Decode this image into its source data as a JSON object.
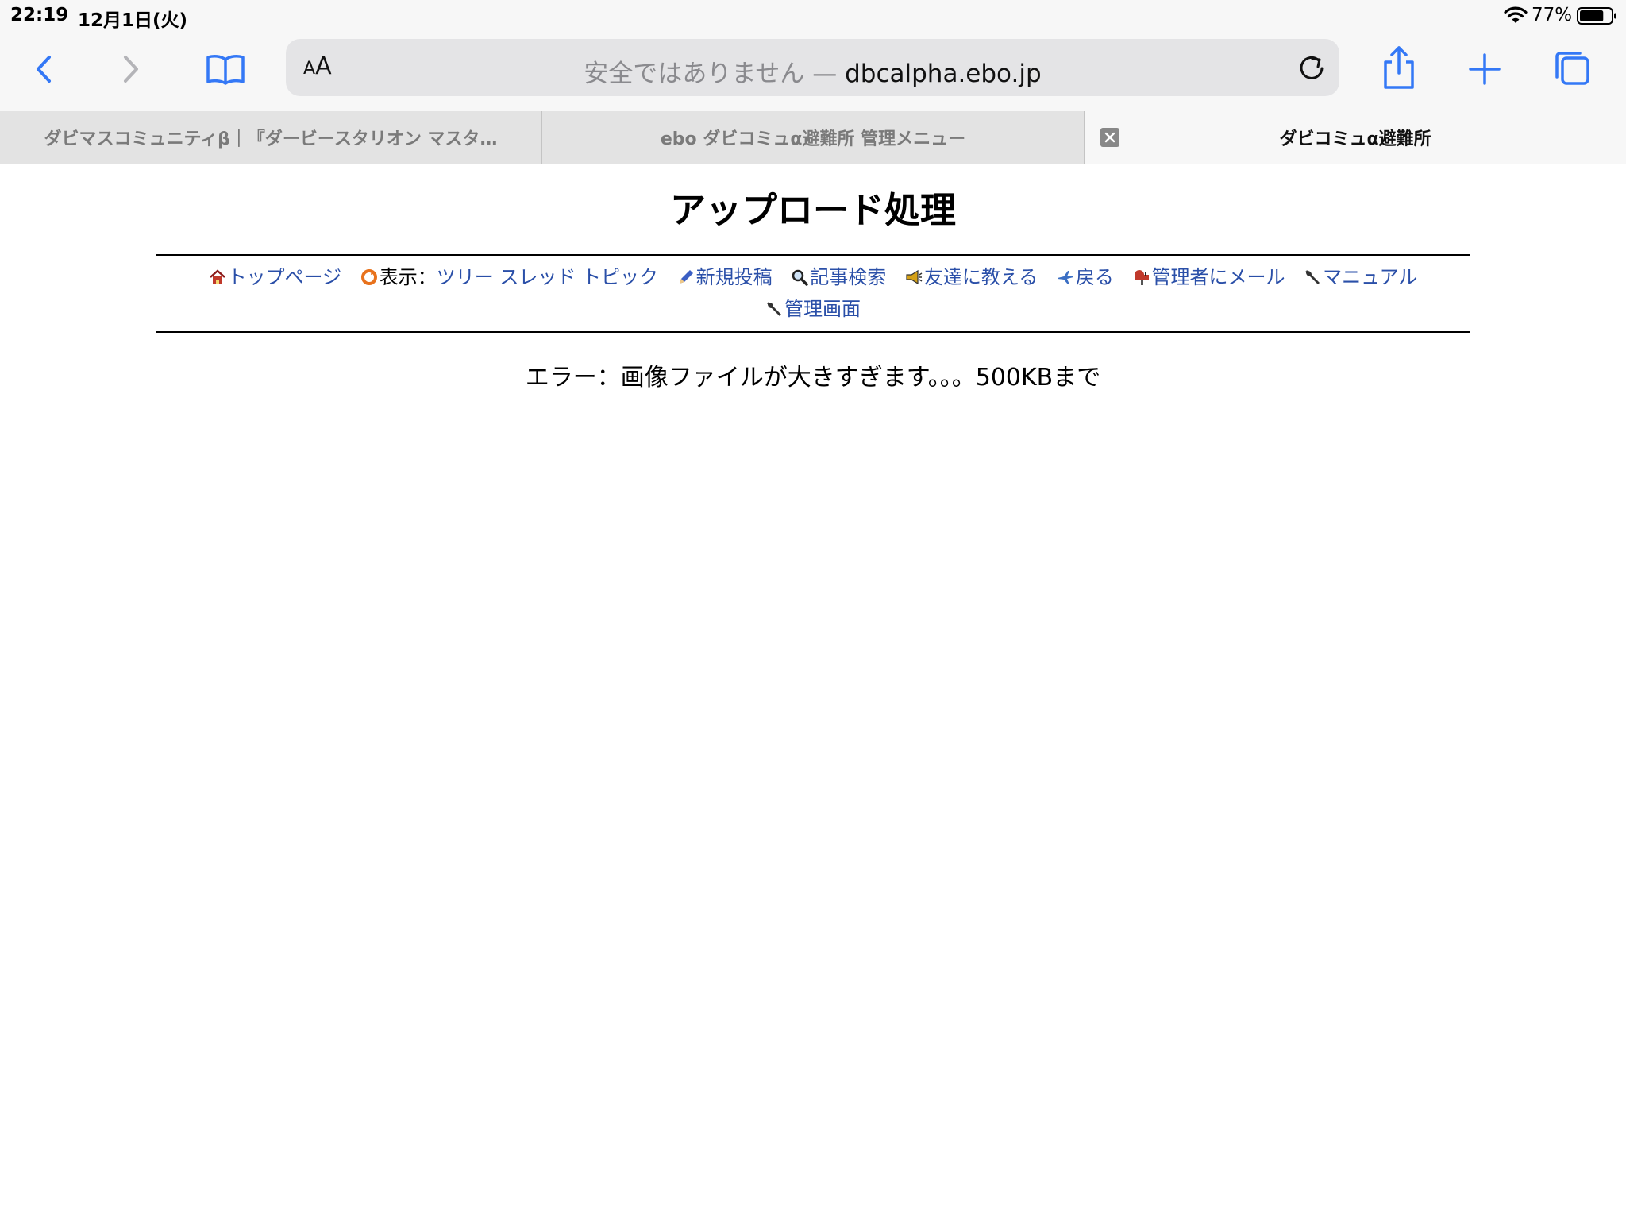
{
  "status_bar": {
    "time": "22:19",
    "date": "12月1日(火)",
    "battery_percent": "77%",
    "battery_level": 0.77
  },
  "toolbar": {
    "reader_label": "AA",
    "address_security": "安全ではありません — ",
    "address_host": "dbcalpha.ebo.jp"
  },
  "tabs": [
    {
      "title": "ダビマスコミュニティβ｜『ダービースタリオン マスタ…",
      "active": false
    },
    {
      "title": "ebo ダビコミュα避難所 管理メニュー",
      "active": false
    },
    {
      "title": "ダビコミュα避難所",
      "active": true
    }
  ],
  "page": {
    "title": "アップロード処理",
    "nav": {
      "top_page": "トップページ",
      "view_label": "表示：",
      "view_tree": "ツリー",
      "view_thread": "スレッド",
      "view_topic": "トピック",
      "new_post": "新規投稿",
      "search": "記事検索",
      "tell_friend": "友達に教える",
      "back": "戻る",
      "mail_admin": "管理者にメール",
      "manual": "マニュアル",
      "admin_screen": "管理画面"
    },
    "error_message": "エラー：画像ファイルが大きすぎます。。。500KBまで"
  },
  "colors": {
    "accent": "#3478f6",
    "link": "#2a4fa8"
  }
}
